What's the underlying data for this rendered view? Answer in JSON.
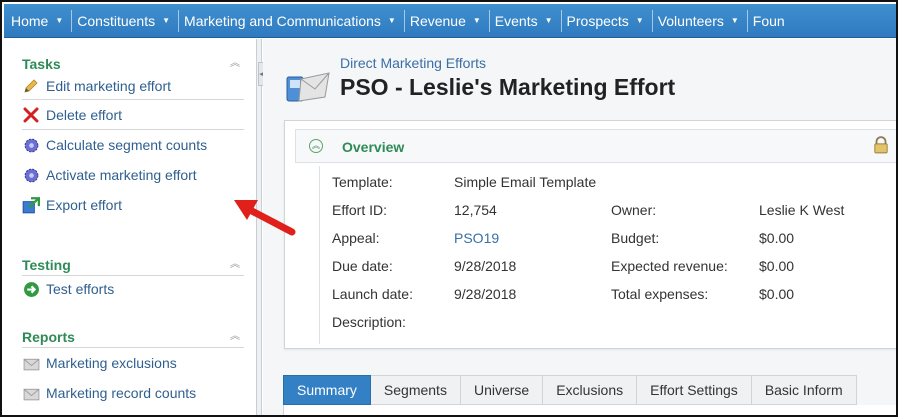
{
  "nav": {
    "items": [
      {
        "label": "Home"
      },
      {
        "label": "Constituents"
      },
      {
        "label": "Marketing and Communications"
      },
      {
        "label": "Revenue"
      },
      {
        "label": "Events"
      },
      {
        "label": "Prospects"
      },
      {
        "label": "Volunteers"
      },
      {
        "label": "Foun"
      }
    ],
    "caret": "▼"
  },
  "sidebar": {
    "tasks": {
      "title": "Tasks",
      "items": [
        {
          "label": "Edit marketing effort",
          "icon": "pencil-icon"
        },
        {
          "label": "Delete effort",
          "icon": "delete-x-icon"
        },
        {
          "label": "Calculate segment counts",
          "icon": "gear-icon"
        },
        {
          "label": "Activate marketing effort",
          "icon": "gear-icon"
        },
        {
          "label": "Export effort",
          "icon": "export-icon"
        }
      ]
    },
    "testing": {
      "title": "Testing",
      "items": [
        {
          "label": "Test efforts",
          "icon": "green-arrow-icon"
        }
      ]
    },
    "reports": {
      "title": "Reports",
      "items": [
        {
          "label": "Marketing exclusions",
          "icon": "envelope-icon"
        },
        {
          "label": "Marketing record counts",
          "icon": "envelope-icon"
        }
      ]
    },
    "collapse_glyph": "︽"
  },
  "page": {
    "breadcrumb": "Direct Marketing Efforts",
    "title": "PSO - Leslie's Marketing Effort"
  },
  "overview": {
    "title": "Overview",
    "toggle_glyph": "︽",
    "fields": {
      "template_label": "Template:",
      "template_value": "Simple Email Template",
      "effort_id_label": "Effort ID:",
      "effort_id_value": "12,754",
      "appeal_label": "Appeal:",
      "appeal_value": "PSO19",
      "due_date_label": "Due date:",
      "due_date_value": "9/28/2018",
      "launch_date_label": "Launch date:",
      "launch_date_value": "9/28/2018",
      "description_label": "Description:",
      "owner_label": "Owner:",
      "owner_value": "Leslie K West",
      "budget_label": "Budget:",
      "budget_value": "$0.00",
      "expected_revenue_label": "Expected revenue:",
      "expected_revenue_value": "$0.00",
      "total_expenses_label": "Total expenses:",
      "total_expenses_value": "$0.00"
    }
  },
  "tabs": [
    {
      "label": "Summary",
      "active": true
    },
    {
      "label": "Segments",
      "active": false
    },
    {
      "label": "Universe",
      "active": false
    },
    {
      "label": "Exclusions",
      "active": false
    },
    {
      "label": "Effort Settings",
      "active": false
    },
    {
      "label": "Basic Inform",
      "active": false
    }
  ],
  "colors": {
    "nav_bg": "#2f7ac0",
    "section_title": "#2e8b57",
    "link": "#2f5f8f",
    "active_tab": "#3380c4",
    "annotation_arrow": "#e0201b"
  }
}
